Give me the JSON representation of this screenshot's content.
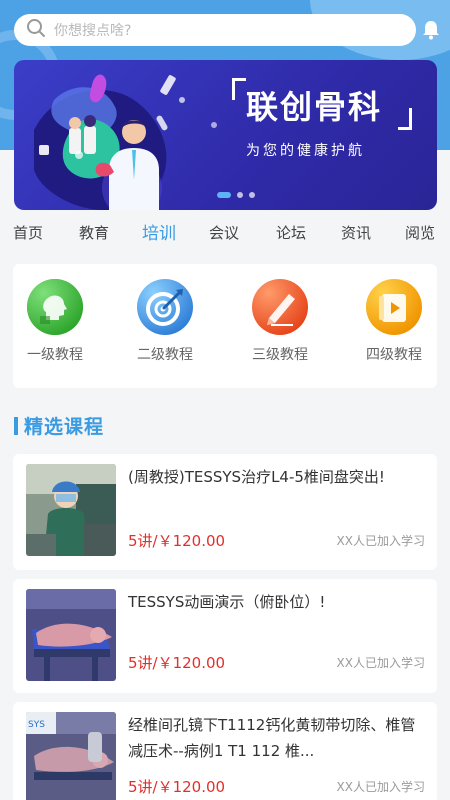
{
  "search": {
    "placeholder": "你想搜点啥?"
  },
  "banner": {
    "title": "联创骨科",
    "subtitle": "为您的健康护航",
    "active_slide": 1,
    "slide_count": 3
  },
  "tabs": [
    {
      "label": "首页",
      "active": false
    },
    {
      "label": "教育",
      "active": false
    },
    {
      "label": "培训",
      "active": true
    },
    {
      "label": "会议",
      "active": false
    },
    {
      "label": "论坛",
      "active": false
    },
    {
      "label": "资讯",
      "active": false
    },
    {
      "label": "阅览",
      "active": false
    }
  ],
  "categories": [
    {
      "label": "一级教程",
      "icon": "head-profile-icon",
      "color": "#3dbb3a"
    },
    {
      "label": "二级教程",
      "icon": "target-arrow-icon",
      "color": "#3a8fe0"
    },
    {
      "label": "三级教程",
      "icon": "pencil-icon",
      "color": "#f25a28"
    },
    {
      "label": "四级教程",
      "icon": "video-book-icon",
      "color": "#f5a400"
    }
  ],
  "section": {
    "title": "精选课程"
  },
  "courses": [
    {
      "title": "(周教授)TESSYS治疗L4-5椎间盘突出!",
      "price": "5讲/￥120.00",
      "enrolled": "XX人已加入学习"
    },
    {
      "title": "TESSYS动画演示（俯卧位）!",
      "price": "5讲/￥120.00",
      "enrolled": "XX人已加入学习"
    },
    {
      "title": "经椎间孔镜下T1112钙化黄韧带切除、椎管减压术--病例1 T1 112 椎...",
      "price": "5讲/￥120.00",
      "enrolled": "XX人已加入学习"
    }
  ],
  "colors": {
    "accent": "#3a9be3",
    "price": "#e0302b",
    "banner": "#3b3ec9"
  }
}
